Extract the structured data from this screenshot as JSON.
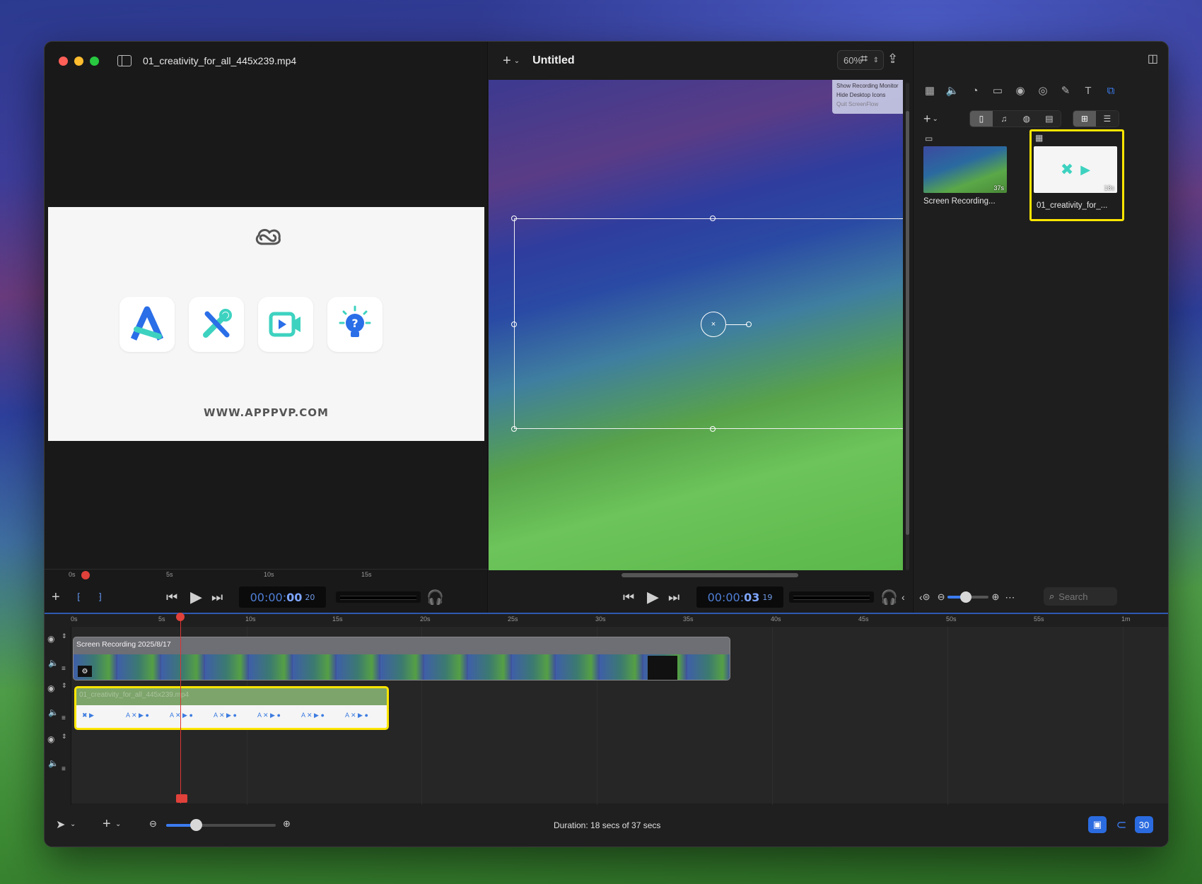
{
  "source": {
    "filename": "01_creativity_for_all_445x239.mp4",
    "preview_url_text": "WWW.APPPVP.COM",
    "ruler_ticks": [
      "0s",
      "5s",
      "10s",
      "15s"
    ],
    "timecode_main": "00:00:",
    "timecode_sec": "00",
    "timecode_frame": "20"
  },
  "canvas": {
    "title": "Untitled",
    "zoom": "60%",
    "menu_items": [
      "Show Recording Monitor",
      "Hide Desktop Icons"
    ],
    "menu_dim_item": "Quit ScreenFlow",
    "timecode_main": "00:00:",
    "timecode_sec": "03",
    "timecode_frame": "19"
  },
  "library": {
    "items": [
      {
        "name": "Screen Recording...",
        "duration": "37s"
      },
      {
        "name": "01_creativity_for_...",
        "duration": "18s"
      }
    ],
    "search_placeholder": "Search"
  },
  "timeline": {
    "ruler_ticks": [
      "0s",
      "5s",
      "10s",
      "15s",
      "20s",
      "25s",
      "30s",
      "35s",
      "40s",
      "45s",
      "50s",
      "55s",
      "1m"
    ],
    "clip1_label": "Screen Recording 2025/8/17",
    "clip2_label": "01_creativity_for_all_445x239.mp4"
  },
  "status": {
    "duration_text": "Duration: 18 secs of 37 secs",
    "fps_badge": "30"
  },
  "colors": {
    "accent": "#3b7cf0",
    "selection": "#ffe600",
    "playhead": "#e0413a"
  }
}
